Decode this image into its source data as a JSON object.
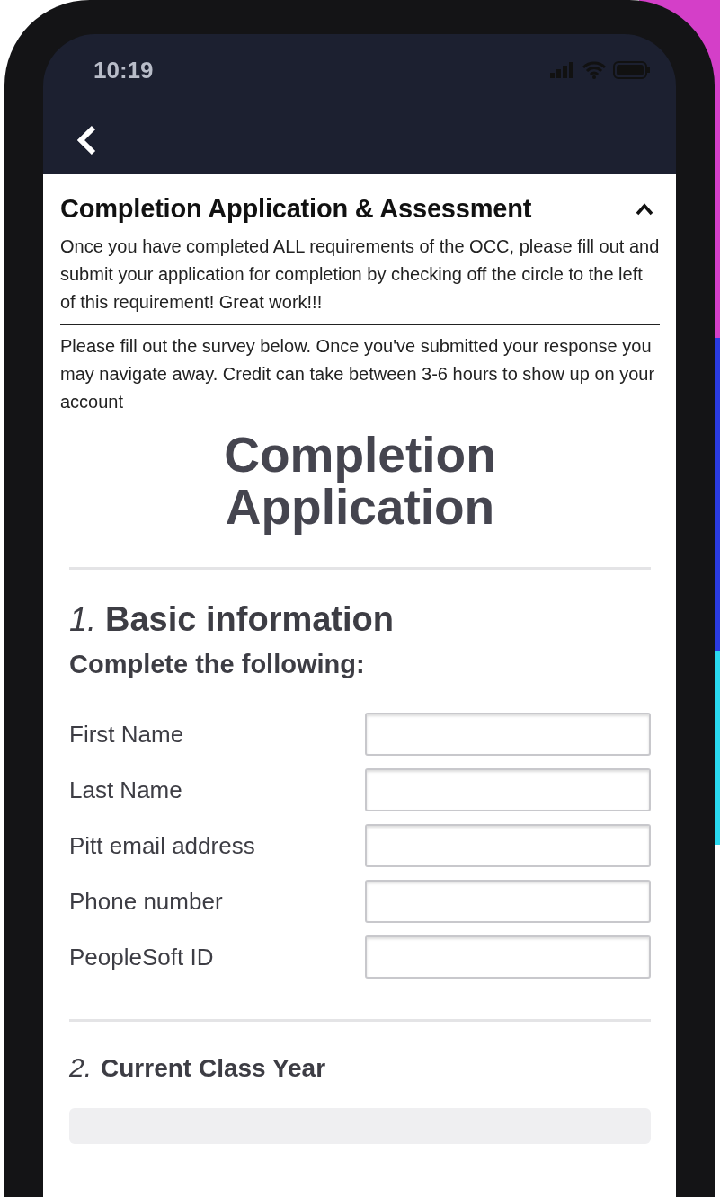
{
  "status_bar": {
    "time": "10:19"
  },
  "section": {
    "title": "Completion Application & Assessment",
    "expanded": true,
    "description": "Once you have completed ALL requirements of the OCC, please fill out and submit your application for completion by checking off the circle to the left of this requirement! Great work!!!",
    "note": "Please fill out the survey below. Once you've submitted your response you may navigate away. Credit can take between 3-6 hours to show up on your account"
  },
  "survey": {
    "title": "Completion Application",
    "questions": [
      {
        "number": "1.",
        "title": "Basic information",
        "subtitle": "Complete the following:",
        "fields": [
          {
            "label": "First Name"
          },
          {
            "label": "Last Name"
          },
          {
            "label": "Pitt email address"
          },
          {
            "label": "Phone number"
          },
          {
            "label": "PeopleSoft ID"
          }
        ]
      },
      {
        "number": "2.",
        "title": "Current Class Year"
      }
    ]
  }
}
